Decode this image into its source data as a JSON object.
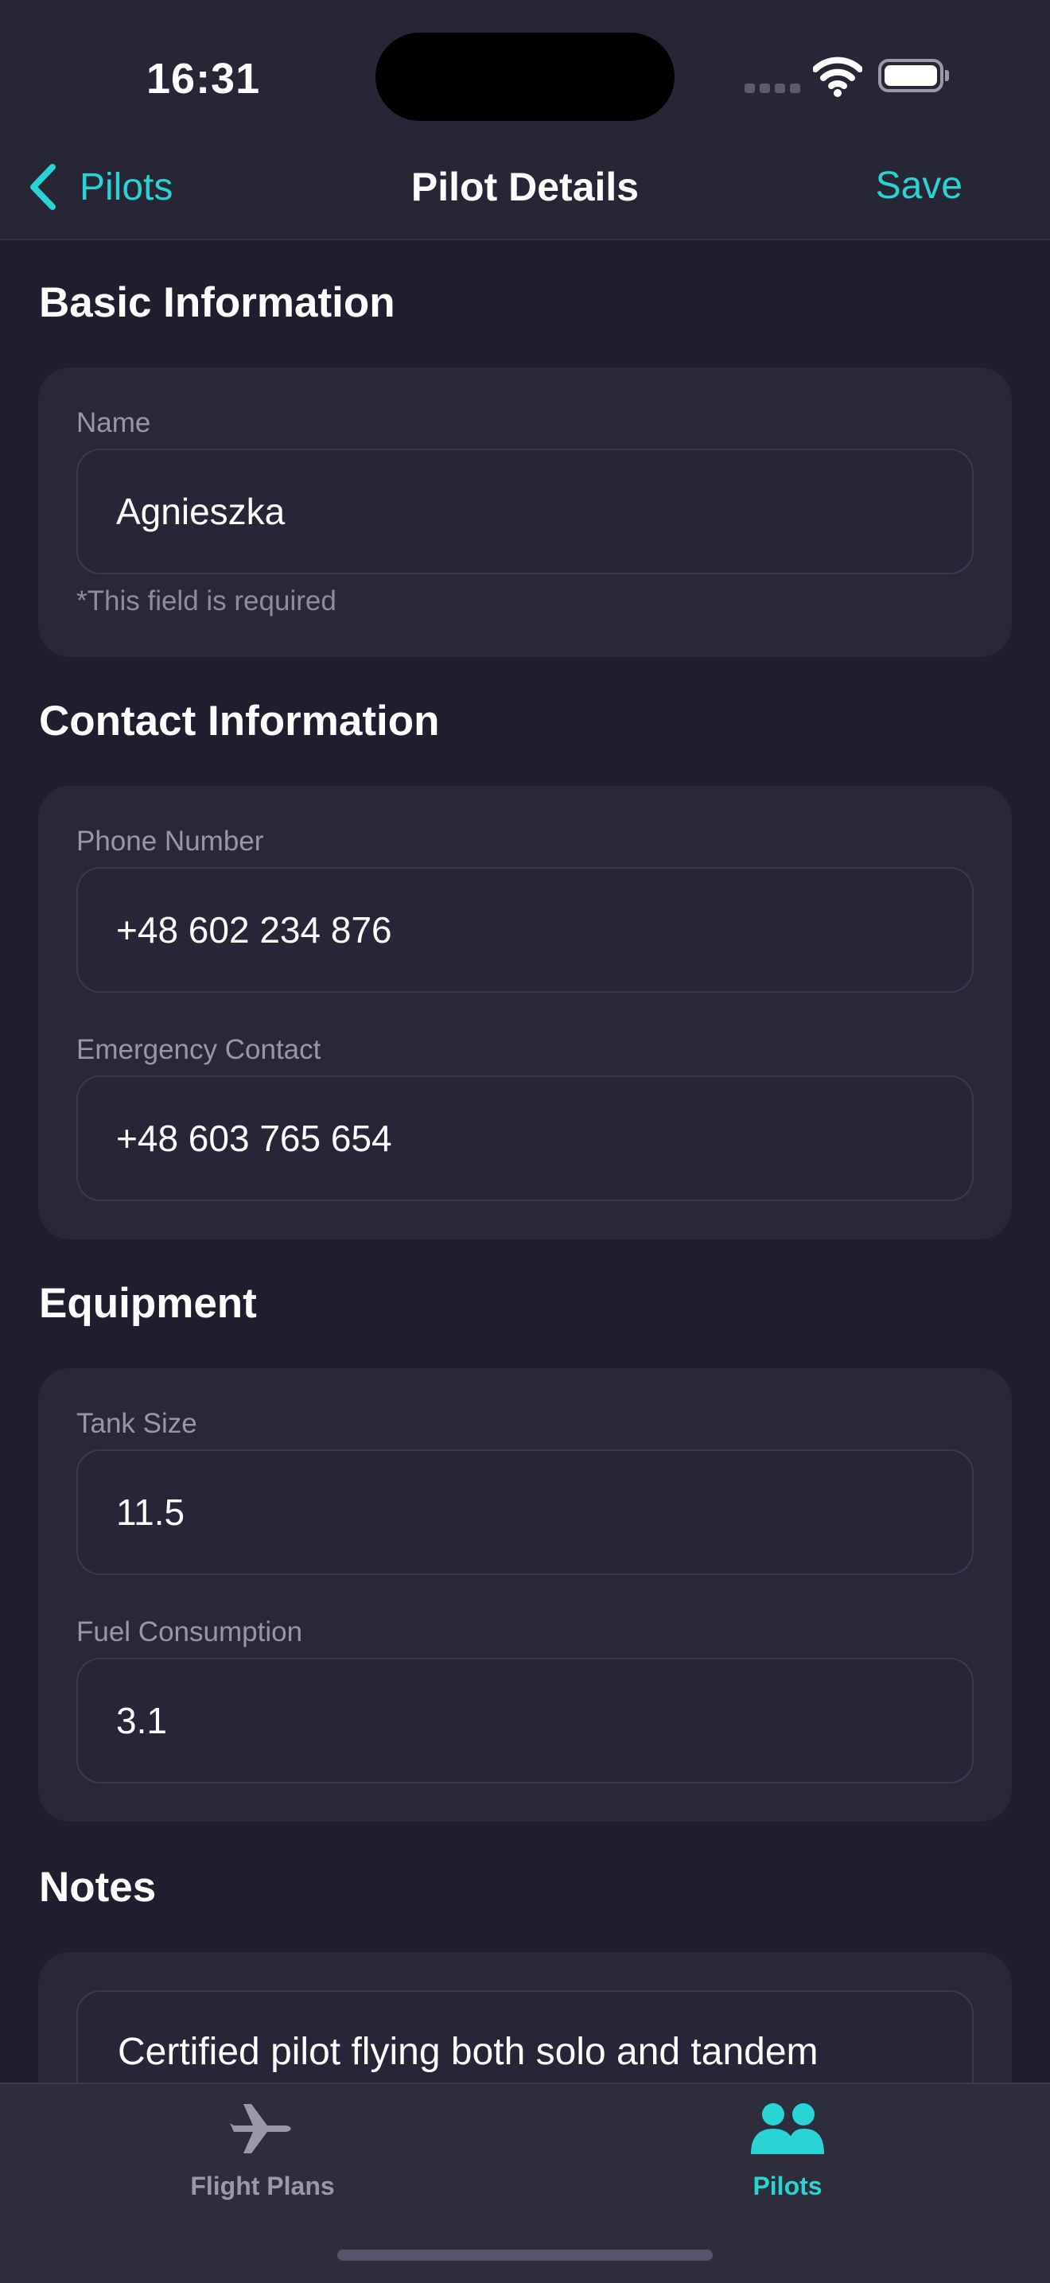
{
  "status_bar": {
    "time": "16:31"
  },
  "nav": {
    "back_label": "Pilots",
    "title": "Pilot Details",
    "save_label": "Save"
  },
  "sections": {
    "basic": {
      "title": "Basic Information",
      "name_label": "Name",
      "name_value": "Agnieszka",
      "name_hint": "*This field is required"
    },
    "contact": {
      "title": "Contact Information",
      "phone_label": "Phone Number",
      "phone_value": "+48 602 234 876",
      "emergency_label": "Emergency Contact",
      "emergency_value": "+48 603 765 654"
    },
    "equipment": {
      "title": "Equipment",
      "tank_label": "Tank Size",
      "tank_value": "11.5",
      "fuel_label": "Fuel Consumption",
      "fuel_value": "3.1"
    },
    "notes": {
      "title": "Notes",
      "value": "Certified pilot flying both solo and tandem"
    }
  },
  "tabbar": {
    "tabs": [
      {
        "label": "Flight Plans",
        "icon": "airplane-icon",
        "active": false
      },
      {
        "label": "Pilots",
        "icon": "people-icon",
        "active": true
      }
    ]
  },
  "colors": {
    "accent": "#2bd4d4",
    "background": "#1f1e2e",
    "card": "#29283a",
    "inactive_tab": "#9a99a8"
  }
}
